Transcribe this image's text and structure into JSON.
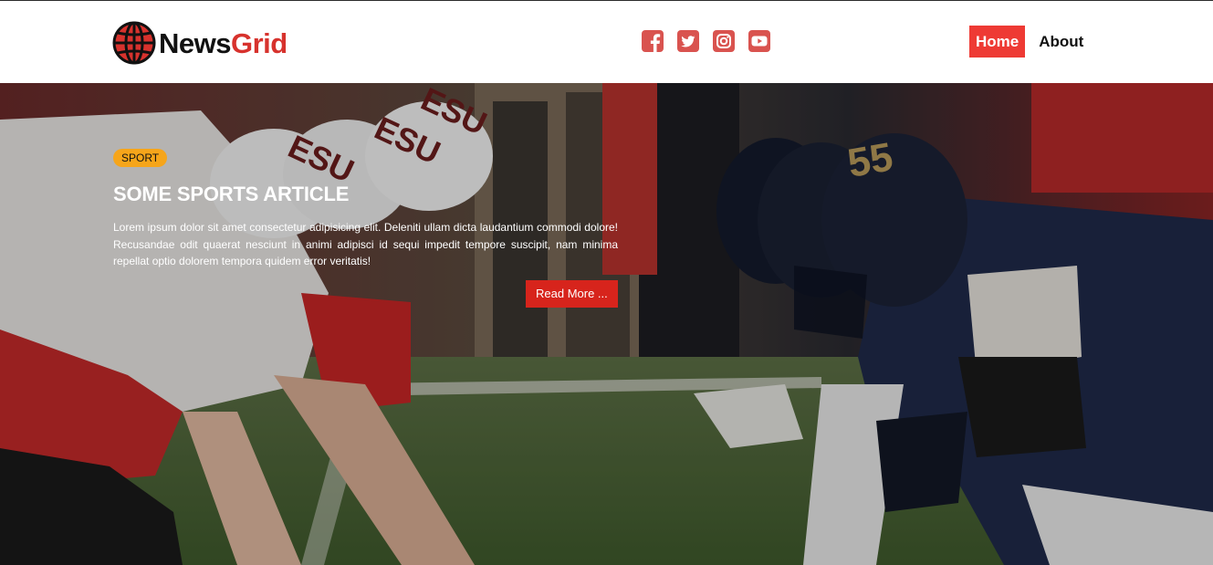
{
  "brand": {
    "name_part1": "News",
    "name_part2": "Grid",
    "logo_icon": "globe-icon",
    "colors": {
      "dark": "#111111",
      "accent": "#d7322d"
    }
  },
  "socials": [
    {
      "icon": "facebook-icon"
    },
    {
      "icon": "twitter-icon"
    },
    {
      "icon": "instagram-icon"
    },
    {
      "icon": "youtube-icon"
    }
  ],
  "nav": {
    "home_label": "Home",
    "about_label": "About",
    "active_color": "#ee3a34"
  },
  "hero": {
    "badge": "SPORT",
    "badge_color": "#f6a51a",
    "title": "SOME SPORTS ARTICLE",
    "body": "Lorem ipsum dolor sit amet consectetur adipisicing elit. Deleniti ullam dicta laudantium commodi dolore! Recusandae odit quaerat nesciunt in animi adipisci id sequi impedit tempore suscipit, nam minima repellat optio dolorem tempora quidem error veritatis!",
    "read_more_label": "Read More ...",
    "button_color": "#d7241c",
    "image_subject": "american-football-line-of-scrimmage",
    "helmet_left_text": "ESU",
    "helmet_right_number": "55"
  }
}
